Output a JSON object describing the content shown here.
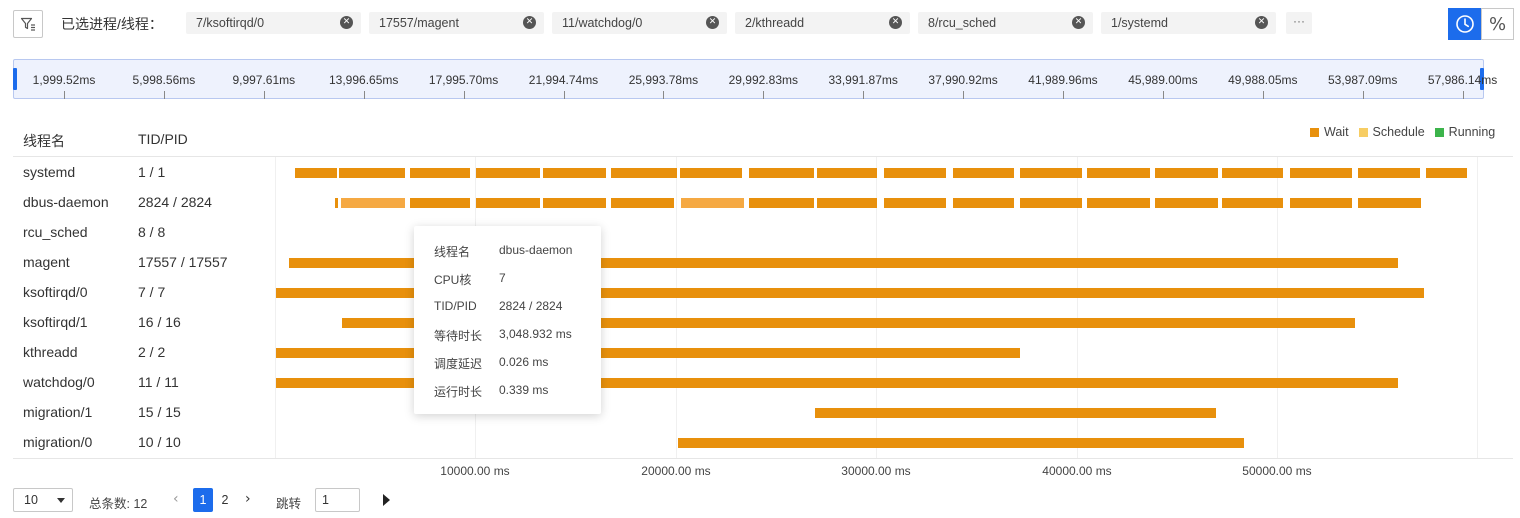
{
  "filter": {
    "selected_label": "已选进程/线程：",
    "chips": [
      "7/ksoftirqd/0",
      "17557/magent",
      "11/watchdog/0",
      "2/kthreadd",
      "8/rcu_sched",
      "1/systemd"
    ],
    "more": "···",
    "percent_label": "%"
  },
  "ruler": {
    "labels": [
      "1,999.52ms",
      "5,998.56ms",
      "9,997.61ms",
      "13,996.65ms",
      "17,995.70ms",
      "21,994.74ms",
      "25,993.78ms",
      "29,992.83ms",
      "33,991.87ms",
      "37,990.92ms",
      "41,989.96ms",
      "45,989.00ms",
      "49,988.05ms",
      "53,987.09ms",
      "57,986.14ms"
    ]
  },
  "legend": [
    {
      "label": "Wait",
      "color": "#e8900c"
    },
    {
      "label": "Schedule",
      "color": "#f7cd63"
    },
    {
      "label": "Running",
      "color": "#3cb44b"
    }
  ],
  "table": {
    "col_name": "线程名",
    "col_tid": "TID/PID",
    "rows": [
      {
        "name": "systemd",
        "tid": "1 / 1"
      },
      {
        "name": "dbus-daemon",
        "tid": "2824 / 2824"
      },
      {
        "name": "rcu_sched",
        "tid": "8 / 8"
      },
      {
        "name": "magent",
        "tid": "17557 / 17557"
      },
      {
        "name": "ksoftirqd/0",
        "tid": "7 / 7"
      },
      {
        "name": "ksoftirqd/1",
        "tid": "16 / 16"
      },
      {
        "name": "kthreadd",
        "tid": "2 / 2"
      },
      {
        "name": "watchdog/0",
        "tid": "11 / 11"
      },
      {
        "name": "migration/1",
        "tid": "15 / 15"
      },
      {
        "name": "migration/0",
        "tid": "10 / 10"
      }
    ]
  },
  "axis": [
    "10000.00 ms",
    "20000.00 ms",
    "30000.00 ms",
    "40000.00 ms",
    "50000.00 ms"
  ],
  "tooltip": {
    "items": [
      {
        "key": "线程名",
        "value": "dbus-daemon"
      },
      {
        "key": "CPU核",
        "value": "7"
      },
      {
        "key": "TID/PID",
        "value": "2824 / 2824"
      },
      {
        "key": "等待时长",
        "value": "3,048.932 ms"
      },
      {
        "key": "调度延迟",
        "value": "0.026 ms"
      },
      {
        "key": "运行时长",
        "value": "0.339 ms"
      }
    ]
  },
  "pagination": {
    "page_size": "10",
    "total_label": "总条数:",
    "total": "12",
    "pages": [
      "1",
      "2"
    ],
    "current": "1",
    "jump_label": "跳转",
    "jump_value": "1",
    "prev": "‹",
    "next": "›"
  }
}
